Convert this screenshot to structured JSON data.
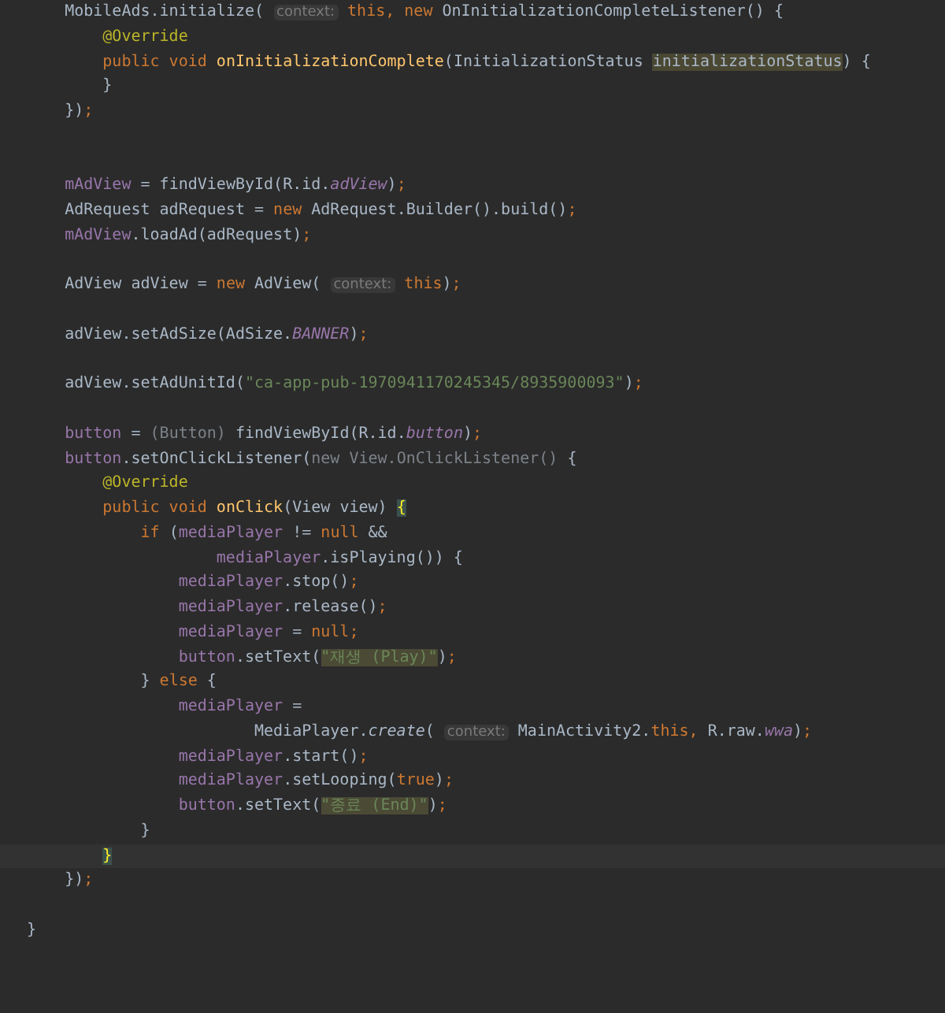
{
  "editor": {
    "lines": [
      {
        "tokens": [
          {
            "kind": "plain",
            "text": "    MobileAds.initialize( "
          },
          {
            "kind": "hint",
            "text": "context:"
          },
          {
            "kind": "keyword",
            "text": " this, new "
          },
          {
            "kind": "plain",
            "text": "OnInitializationCompleteListener() {"
          }
        ]
      },
      {
        "tokens": [
          {
            "kind": "annotation",
            "text": "        @Override"
          }
        ]
      },
      {
        "tokens": [
          {
            "kind": "keyword",
            "text": "        public void "
          },
          {
            "kind": "method",
            "text": "onInitializationComplete"
          },
          {
            "kind": "plain",
            "text": "(InitializationStatus "
          },
          {
            "kind": "param-hl",
            "text": "initializationStatus"
          },
          {
            "kind": "plain",
            "text": ") {"
          }
        ]
      },
      {
        "tokens": [
          {
            "kind": "plain",
            "text": "        }"
          }
        ]
      },
      {
        "tokens": [
          {
            "kind": "plain",
            "text": "    })"
          },
          {
            "kind": "keyword",
            "text": ";"
          }
        ]
      },
      {
        "kind": "blank"
      },
      {
        "kind": "blank"
      },
      {
        "tokens": [
          {
            "kind": "field",
            "text": "    mAdView"
          },
          {
            "kind": "plain",
            "text": " = findViewById(R.id."
          },
          {
            "kind": "static-field",
            "text": "adView"
          },
          {
            "kind": "plain",
            "text": ")"
          },
          {
            "kind": "keyword",
            "text": ";"
          }
        ]
      },
      {
        "tokens": [
          {
            "kind": "plain",
            "text": "    AdRequest adRequest = "
          },
          {
            "kind": "keyword",
            "text": "new "
          },
          {
            "kind": "plain",
            "text": "AdRequest.Builder().build()"
          },
          {
            "kind": "keyword",
            "text": ";"
          }
        ]
      },
      {
        "tokens": [
          {
            "kind": "field",
            "text": "    mAdView"
          },
          {
            "kind": "plain",
            "text": ".loadAd(adRequest)"
          },
          {
            "kind": "keyword",
            "text": ";"
          }
        ]
      },
      {
        "kind": "blank"
      },
      {
        "tokens": [
          {
            "kind": "plain",
            "text": "    AdView adView = "
          },
          {
            "kind": "keyword",
            "text": "new "
          },
          {
            "kind": "plain",
            "text": "AdView( "
          },
          {
            "kind": "hint",
            "text": "context:"
          },
          {
            "kind": "keyword",
            "text": " this"
          },
          {
            "kind": "plain",
            "text": ")"
          },
          {
            "kind": "keyword",
            "text": ";"
          }
        ]
      },
      {
        "kind": "blank"
      },
      {
        "tokens": [
          {
            "kind": "plain",
            "text": "    adView.setAdSize(AdSize."
          },
          {
            "kind": "static-field",
            "text": "BANNER"
          },
          {
            "kind": "plain",
            "text": ")"
          },
          {
            "kind": "keyword",
            "text": ";"
          }
        ]
      },
      {
        "kind": "blank"
      },
      {
        "tokens": [
          {
            "kind": "plain",
            "text": "    adView.setAdUnitId("
          },
          {
            "kind": "string",
            "text": "\"ca-app-pub-1970941170245345/8935900093\""
          },
          {
            "kind": "plain",
            "text": ")"
          },
          {
            "kind": "keyword",
            "text": ";"
          }
        ]
      },
      {
        "kind": "blank"
      },
      {
        "tokens": [
          {
            "kind": "field",
            "text": "    button"
          },
          {
            "kind": "plain",
            "text": " = "
          },
          {
            "kind": "faded",
            "text": "(Button)"
          },
          {
            "kind": "plain",
            "text": " findViewById(R.id."
          },
          {
            "kind": "static-field",
            "text": "button"
          },
          {
            "kind": "plain",
            "text": ")"
          },
          {
            "kind": "keyword",
            "text": ";"
          }
        ]
      },
      {
        "tokens": [
          {
            "kind": "field",
            "text": "    button"
          },
          {
            "kind": "plain",
            "text": ".setOnClickListener("
          },
          {
            "kind": "faded",
            "text": "new View.OnClickListener()"
          },
          {
            "kind": "plain",
            "text": " {"
          }
        ]
      },
      {
        "tokens": [
          {
            "kind": "annotation",
            "text": "        @Override"
          }
        ]
      },
      {
        "tokens": [
          {
            "kind": "keyword",
            "text": "        public void "
          },
          {
            "kind": "method",
            "text": "onClick"
          },
          {
            "kind": "plain",
            "text": "(View view) "
          },
          {
            "kind": "brace",
            "text": "{"
          }
        ]
      },
      {
        "tokens": [
          {
            "kind": "keyword",
            "text": "            if "
          },
          {
            "kind": "plain",
            "text": "("
          },
          {
            "kind": "field",
            "text": "mediaPlayer"
          },
          {
            "kind": "plain",
            "text": " != "
          },
          {
            "kind": "keyword",
            "text": "null "
          },
          {
            "kind": "plain",
            "text": "&&"
          }
        ]
      },
      {
        "tokens": [
          {
            "kind": "field",
            "text": "                    mediaPlayer"
          },
          {
            "kind": "plain",
            "text": ".isPlaying()) {"
          }
        ]
      },
      {
        "tokens": [
          {
            "kind": "field",
            "text": "                mediaPlayer"
          },
          {
            "kind": "plain",
            "text": ".stop()"
          },
          {
            "kind": "keyword",
            "text": ";"
          }
        ]
      },
      {
        "tokens": [
          {
            "kind": "field",
            "text": "                mediaPlayer"
          },
          {
            "kind": "plain",
            "text": ".release()"
          },
          {
            "kind": "keyword",
            "text": ";"
          }
        ]
      },
      {
        "tokens": [
          {
            "kind": "field",
            "text": "                mediaPlayer"
          },
          {
            "kind": "plain",
            "text": " = "
          },
          {
            "kind": "keyword",
            "text": "null;"
          }
        ]
      },
      {
        "tokens": [
          {
            "kind": "field",
            "text": "                button"
          },
          {
            "kind": "plain",
            "text": ".setText("
          },
          {
            "kind": "string-hl",
            "text": "\"재생 (Play)\""
          },
          {
            "kind": "plain",
            "text": ")"
          },
          {
            "kind": "keyword",
            "text": ";"
          }
        ]
      },
      {
        "tokens": [
          {
            "kind": "plain",
            "text": "            } "
          },
          {
            "kind": "keyword",
            "text": "else "
          },
          {
            "kind": "plain",
            "text": "{"
          }
        ]
      },
      {
        "tokens": [
          {
            "kind": "field",
            "text": "                mediaPlayer"
          },
          {
            "kind": "plain",
            "text": " ="
          }
        ]
      },
      {
        "tokens": [
          {
            "kind": "plain",
            "text": "                        MediaPlayer."
          },
          {
            "kind": "static-call",
            "text": "create"
          },
          {
            "kind": "plain",
            "text": "( "
          },
          {
            "kind": "hint",
            "text": "context:"
          },
          {
            "kind": "plain",
            "text": " MainActivity2."
          },
          {
            "kind": "keyword",
            "text": "this, "
          },
          {
            "kind": "plain",
            "text": "R.raw."
          },
          {
            "kind": "static-field",
            "text": "wwa"
          },
          {
            "kind": "plain",
            "text": ")"
          },
          {
            "kind": "keyword",
            "text": ";"
          }
        ]
      },
      {
        "tokens": [
          {
            "kind": "field",
            "text": "                mediaPlayer"
          },
          {
            "kind": "plain",
            "text": ".start()"
          },
          {
            "kind": "keyword",
            "text": ";"
          }
        ]
      },
      {
        "tokens": [
          {
            "kind": "field",
            "text": "                mediaPlayer"
          },
          {
            "kind": "plain",
            "text": ".setLooping("
          },
          {
            "kind": "keyword",
            "text": "true"
          },
          {
            "kind": "plain",
            "text": ")"
          },
          {
            "kind": "keyword",
            "text": ";"
          }
        ]
      },
      {
        "tokens": [
          {
            "kind": "field",
            "text": "                button"
          },
          {
            "kind": "plain",
            "text": ".setText("
          },
          {
            "kind": "string-hl",
            "text": "\"종료 (End)\""
          },
          {
            "kind": "plain",
            "text": ")"
          },
          {
            "kind": "keyword",
            "text": ";"
          }
        ]
      },
      {
        "tokens": [
          {
            "kind": "plain",
            "text": "            }"
          }
        ]
      },
      {
        "kind": "caret",
        "tokens": [
          {
            "kind": "brace",
            "text": "}"
          }
        ]
      },
      {
        "tokens": [
          {
            "kind": "plain",
            "text": "    })"
          },
          {
            "kind": "keyword",
            "text": ";"
          }
        ]
      },
      {
        "kind": "blank"
      },
      {
        "tokens": [
          {
            "kind": "plain",
            "text": "}"
          }
        ]
      }
    ]
  }
}
